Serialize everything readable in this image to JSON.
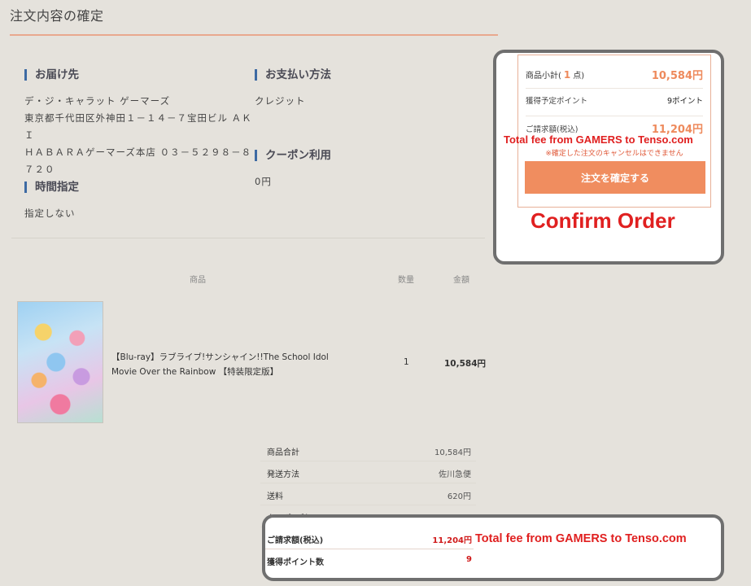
{
  "page": {
    "title": "注文内容の確定"
  },
  "delivery": {
    "heading": "お届け先",
    "lines": [
      "デ・ジ・キャラット ゲーマーズ",
      "東京都千代田区外神田１－１４－７宝田ビル ＡＫＩ",
      "ＨＡＢＡＲＡゲーマーズ本店 ０３－５２９８－８",
      "７２０"
    ]
  },
  "time": {
    "heading": "時間指定",
    "value": "指定しない"
  },
  "payment": {
    "heading": "お支払い方法",
    "value": "クレジット"
  },
  "coupon": {
    "heading": "クーポン利用",
    "value": "0円"
  },
  "table": {
    "headers": {
      "product": "商品",
      "qty": "数量",
      "amount": "金額"
    },
    "item": {
      "title_line1": "【Blu-ray】ラブライブ!サンシャイン!!The School Idol",
      "title_line2": "Movie Over the Rainbow 【特装限定版】",
      "qty": "1",
      "amount": "10,584円"
    }
  },
  "summary": {
    "subtotal_label": "商品合計",
    "subtotal_value": "10,584円",
    "shipping_method_label": "発送方法",
    "shipping_method_value": "佐川急便",
    "shipping_fee_label": "送料",
    "shipping_fee_value": "620円",
    "coupon_label": "クーポン利用",
    "coupon_value": "0円",
    "total_label": "ご請求額(税込)",
    "total_value": "11,204円",
    "points_label": "獲得ポイント数",
    "points_value": "9"
  },
  "confirm_panel": {
    "subtotal_label": "商品小計(",
    "subtotal_count": "1",
    "subtotal_unit": "点)",
    "subtotal_value": "10,584円",
    "points_label": "獲得予定ポイント",
    "points_value": "9ポイント",
    "total_label": "ご請求額(税込)",
    "total_value": "11,204円",
    "note": "※確定した注文のキャンセルはできません",
    "button_label": "注文を確定する"
  },
  "annotations": {
    "fee_note": "Total fee from GAMERS to Tenso.com",
    "confirm_label": "Confirm Order",
    "fee_note_bottom": "Total fee from GAMERS to Tenso.com"
  },
  "colors": {
    "accent": "#f08d5f",
    "price": "#ee8a5c",
    "total_red": "#d01a1a",
    "heading_bar": "#3d6aa3",
    "annotation": "#e02020"
  }
}
